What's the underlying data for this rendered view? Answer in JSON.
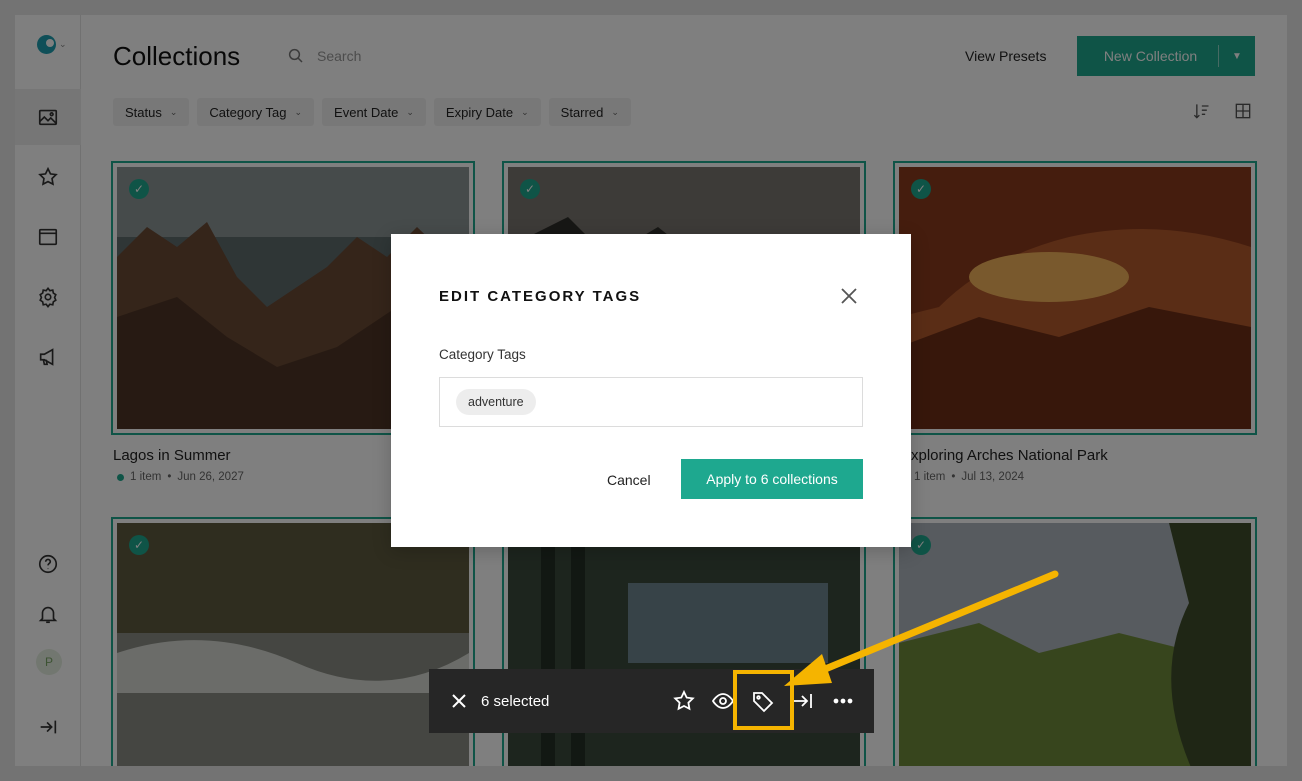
{
  "app": {
    "title": "Collections"
  },
  "search": {
    "placeholder": "Search"
  },
  "header": {
    "view_presets": "View Presets",
    "new_collection": "New Collection"
  },
  "filters": [
    "Status",
    "Category Tag",
    "Event Date",
    "Expiry Date",
    "Starred"
  ],
  "sidebar": {
    "avatar_initial": "P"
  },
  "collections": [
    {
      "title": "Lagos in Summer",
      "count": "1 item",
      "date": "Jun 26, 2027"
    },
    {
      "title": "",
      "count": "",
      "date": ""
    },
    {
      "title": "xploring Arches National Park",
      "count": "1 item",
      "date": "Jul 13, 2024"
    }
  ],
  "modal": {
    "title": "EDIT CATEGORY TAGS",
    "field_label": "Category Tags",
    "tags": [
      "adventure"
    ],
    "cancel": "Cancel",
    "apply": "Apply to 6 collections"
  },
  "selection_bar": {
    "label": "6 selected"
  },
  "colors": {
    "accent": "#1ea88f",
    "highlight": "#f5b400",
    "bar_bg": "#262626"
  }
}
